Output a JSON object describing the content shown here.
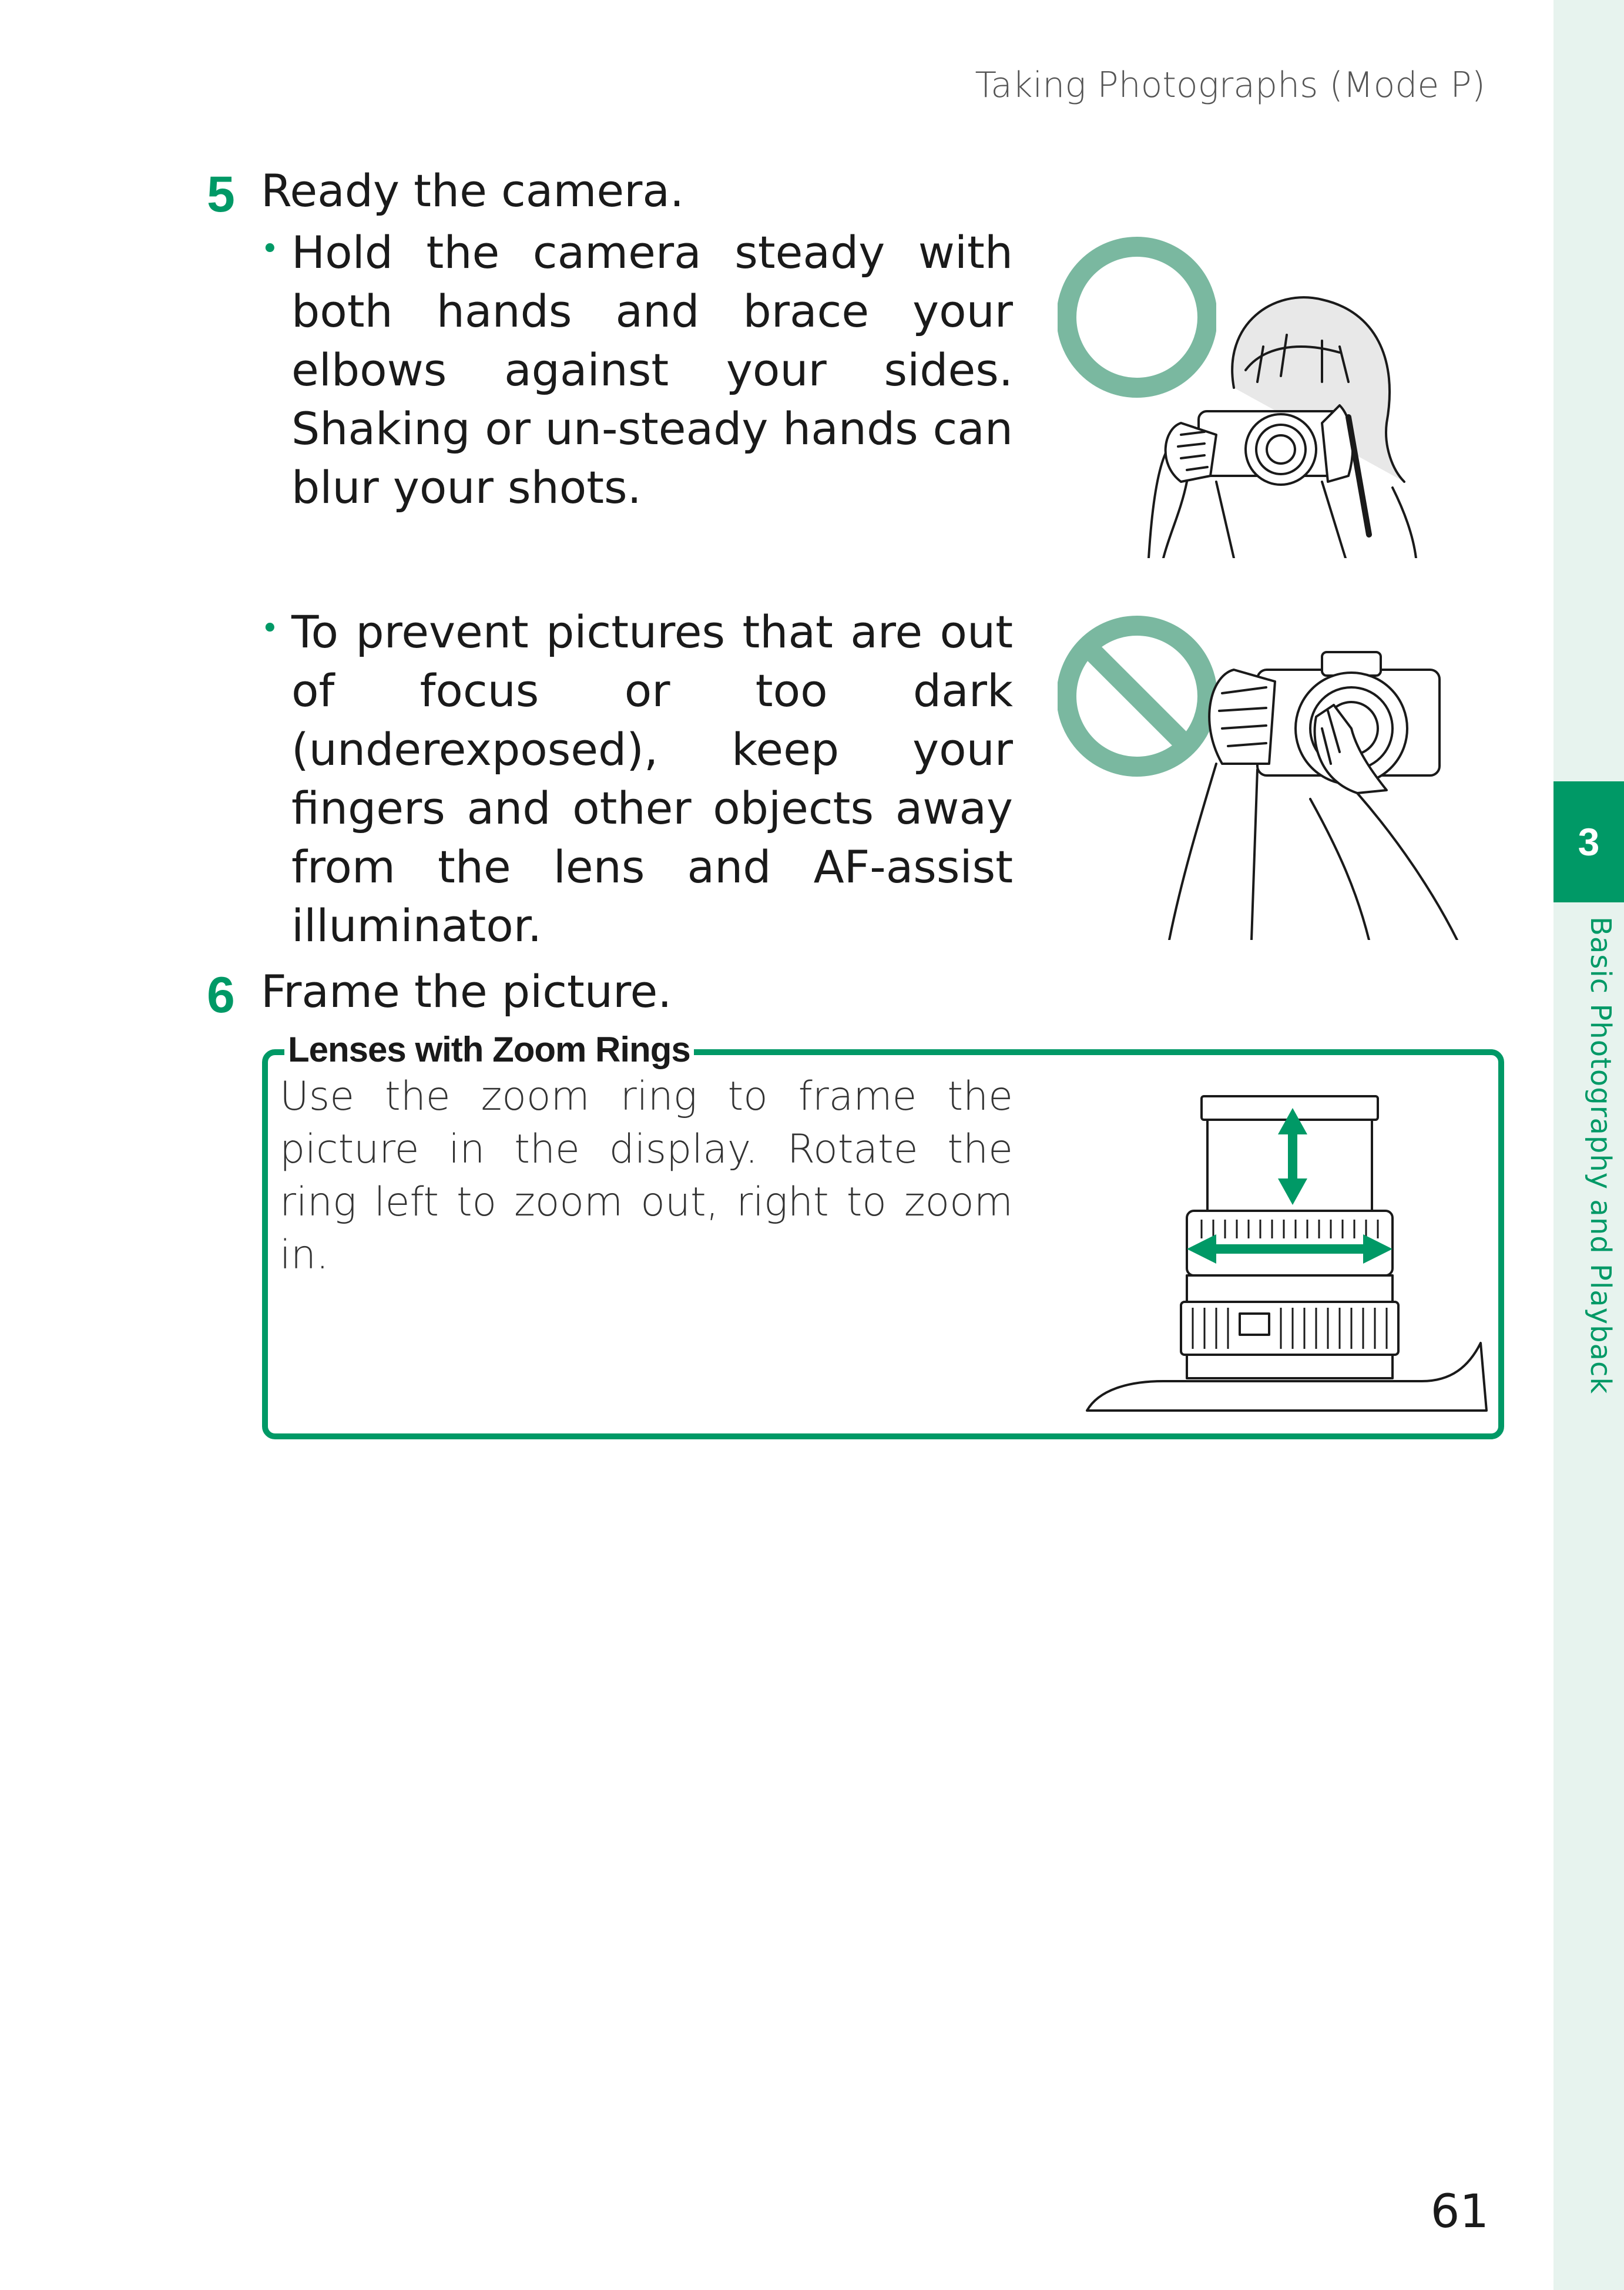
{
  "header": {
    "section_title": "Taking Photographs (Mode P)"
  },
  "steps": [
    {
      "number": "5",
      "title": "Ready the camera."
    },
    {
      "number": "6",
      "title": "Frame the picture."
    }
  ],
  "bullets": [
    {
      "marker": "•",
      "text": "Hold the camera steady with both hands and brace your elbows against your sides. Shaking or un-steady hands can blur your shots."
    },
    {
      "marker": "•",
      "text": "To prevent pictures that are out of focus or too dark (underexposed), keep your fingers and other objects away from the lens and AF-assist illuminator."
    }
  ],
  "note": {
    "title": "Lenses with Zoom Rings",
    "text": "Use the zoom ring to frame the picture in the display. Rotate the ring left to zoom out, right to zoom in."
  },
  "sidebar": {
    "chapter_number": "3",
    "chapter_title": "Basic Photography and Playback"
  },
  "page_number": "61",
  "colors": {
    "accent": "#009966",
    "symbol": "#7ab8a0",
    "sidebar_bg": "#e7f3ee"
  }
}
